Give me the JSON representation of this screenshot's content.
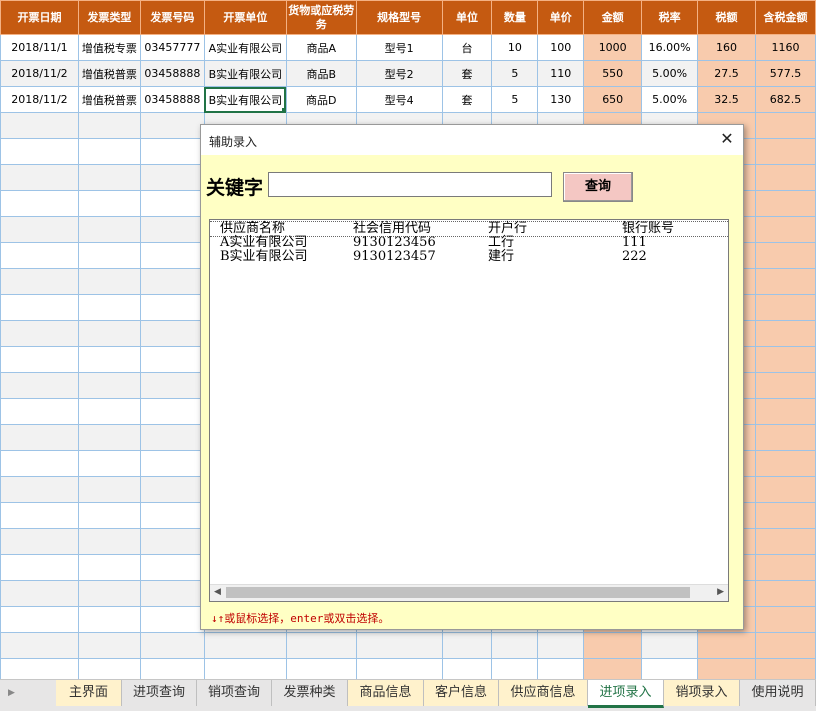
{
  "sheet": {
    "headers": [
      "开票日期",
      "发票类型",
      "发票号码",
      "开票单位",
      "货物或应税劳务",
      "规格型号",
      "单位",
      "数量",
      "单价",
      "金额",
      "税率",
      "税额",
      "含税金额"
    ],
    "rows": [
      [
        "2018/11/1",
        "增值税专票",
        "03457777",
        "A实业有限公司",
        "商品A",
        "型号1",
        "台",
        "10",
        "100",
        "1000",
        "16.00%",
        "160",
        "1160"
      ],
      [
        "2018/11/2",
        "增值税普票",
        "03458888",
        "B实业有限公司",
        "商品B",
        "型号2",
        "套",
        "5",
        "110",
        "550",
        "5.00%",
        "27.5",
        "577.5"
      ],
      [
        "2018/11/2",
        "增值税普票",
        "03458888",
        "B实业有限公司",
        "商品D",
        "型号4",
        "套",
        "5",
        "130",
        "650",
        "5.00%",
        "32.5",
        "682.5"
      ]
    ]
  },
  "dialog": {
    "title": "辅助录入",
    "close_glyph": "✕",
    "keyword_label": "关键字",
    "keyword_value": "",
    "search_label": "查询",
    "list_headers": [
      "供应商名称",
      "社会信用代码",
      "开户行",
      "银行账号"
    ],
    "list_rows": [
      [
        "A实业有限公司",
        "9130123456",
        "工行",
        "111"
      ],
      [
        "B实业有限公司",
        "9130123457",
        "建行",
        "222"
      ]
    ],
    "hint": "↓↑或鼠标选择，enter或双击选择。"
  },
  "tabs": [
    {
      "label": "主界面",
      "style": "yellow"
    },
    {
      "label": "进项查询",
      "style": "grey"
    },
    {
      "label": "销项查询",
      "style": "grey"
    },
    {
      "label": "发票种类",
      "style": "grey"
    },
    {
      "label": "商品信息",
      "style": "yellow"
    },
    {
      "label": "客户信息",
      "style": "yellow"
    },
    {
      "label": "供应商信息",
      "style": "yellow"
    },
    {
      "label": "进项录入",
      "style": "active"
    },
    {
      "label": "销项录入",
      "style": "yellow"
    },
    {
      "label": "使用说明",
      "style": "grey"
    }
  ],
  "colors": {
    "header": "#c55a11",
    "amount": "#f8cbad",
    "dialog_bg": "#ffffc4",
    "hint": "#c00000",
    "active_tab": "#217346"
  },
  "icons": {
    "tab_nav": "triangle-right-icon",
    "close": "close-icon",
    "scroll_left": "scroll-left-icon",
    "scroll_right": "scroll-right-icon"
  }
}
